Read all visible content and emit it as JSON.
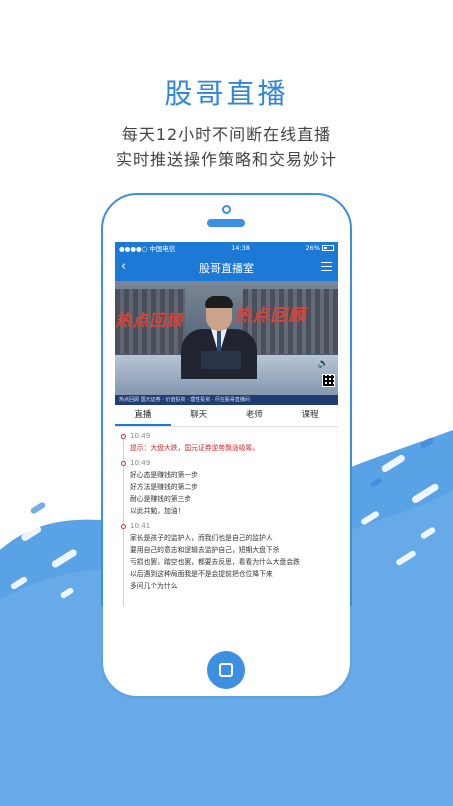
{
  "promo": {
    "headline": "股哥直播",
    "subtitle_1": "每天12小时不间断在线直播",
    "subtitle_2": "实时推送操作策略和交易妙计"
  },
  "phone": {
    "status_bar": {
      "carrier": "●●●●○ 中国电信",
      "time": "14:38",
      "battery": "26%"
    },
    "nav": {
      "title": "股哥直播室"
    },
    "video": {
      "banner_left": "热点回顾",
      "banner_right": "热点回顾",
      "ticker": "热点回顾  国元证券 · 价值投资 · 理性投资 · 尽在股哥直播间"
    },
    "tabs": [
      {
        "label": "直播",
        "active": true
      },
      {
        "label": "聊天",
        "active": false
      },
      {
        "label": "老师",
        "active": false
      },
      {
        "label": "课程",
        "active": false
      }
    ],
    "feed": [
      {
        "time": "10:49",
        "lines": [
          "提示：大盘大跌，国元证券逆势飘涨吸筹。"
        ],
        "highlight": true
      },
      {
        "time": "10:49",
        "lines": [
          "好心态是赚钱的第一步",
          "好方法是赚钱的第二步",
          "耐心是赚钱的第三步",
          "以此共勉，加油！"
        ],
        "highlight": false
      },
      {
        "time": "10:41",
        "lines": [
          "家长是孩子的监护人，而我们也是自己的监护人",
          "要用自己的意志和逻辑去监护自己，短期大盘下杀",
          "亏损也罢，踏空也罢，都要去反思，看看为什么大盘会跌",
          "以后遇到这种局面我是不是会提前把仓位降下来",
          "多问几个为什么"
        ],
        "highlight": false
      }
    ]
  },
  "colors": {
    "brand_blue": "#1d79d6",
    "headline_blue": "#2f86d6",
    "alert_red": "#d42b2b"
  }
}
